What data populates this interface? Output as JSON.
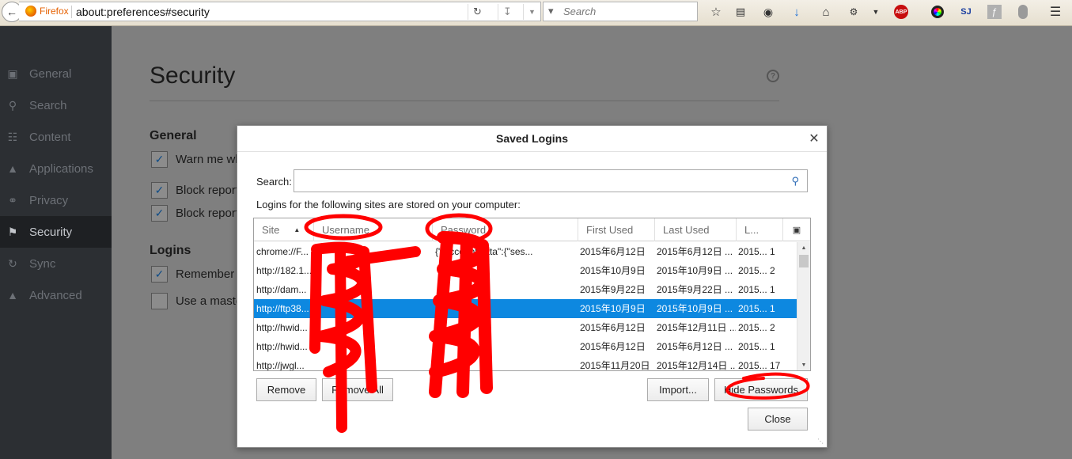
{
  "toolbar": {
    "identity_label": "Firefox",
    "url": "about:preferences#security",
    "search_placeholder": "Search",
    "icons": [
      "back-icon",
      "reload-icon",
      "download-arrow-icon",
      "dropdown-icon",
      "search-icon",
      "star-icon",
      "reading-list-icon",
      "pocket-icon",
      "download-icon",
      "home-icon",
      "extension-icon",
      "abp-icon",
      "color-wheel-icon",
      "sj-icon",
      "flash-icon",
      "addon-icon",
      "menu-icon"
    ],
    "abp_label": "ABP",
    "sj_label": "SJ"
  },
  "sidebar": {
    "items": [
      {
        "label": "General",
        "icon": "general-icon"
      },
      {
        "label": "Search",
        "icon": "search-icon"
      },
      {
        "label": "Content",
        "icon": "content-icon"
      },
      {
        "label": "Applications",
        "icon": "applications-icon"
      },
      {
        "label": "Privacy",
        "icon": "privacy-mask-icon"
      },
      {
        "label": "Security",
        "icon": "lock-icon",
        "active": true
      },
      {
        "label": "Sync",
        "icon": "sync-icon"
      },
      {
        "label": "Advanced",
        "icon": "advanced-icon"
      }
    ]
  },
  "content": {
    "title": "Security",
    "help_glyph": "?",
    "general_heading": "General",
    "general_options": [
      {
        "label": "Warn me wh",
        "checked": true
      },
      {
        "label": "Block report",
        "checked": true
      },
      {
        "label": "Block report",
        "checked": true
      }
    ],
    "logins_heading": "Logins",
    "logins_options": [
      {
        "label": "Remember l",
        "checked": true
      },
      {
        "label": "Use a maste",
        "checked": false
      }
    ]
  },
  "dialog": {
    "title": "Saved Logins",
    "search_label": "Search:",
    "search_value": "",
    "description": "Logins for the following sites are stored on your computer:",
    "columns": [
      "Site",
      "Username",
      "Password",
      "First Used",
      "Last Used",
      "L..."
    ],
    "rows": [
      {
        "site": "chrome://F...",
        "username": "",
        "password": "{\"...ccountData\":{\"ses...",
        "first": "2015年6月12日",
        "last": "2015年6月12日 ...",
        "changed": "2015...",
        "count": "1"
      },
      {
        "site": "http://182.1...",
        "username": "",
        "password": "",
        "first": "2015年10月9日",
        "last": "2015年10月9日 ...",
        "changed": "2015...",
        "count": "2"
      },
      {
        "site": "http://dam...",
        "username": "",
        "password": "",
        "first": "2015年9月22日",
        "last": "2015年9月22日 ...",
        "changed": "2015...",
        "count": "1"
      },
      {
        "site": "http://ftp38...",
        "username": "",
        "password": "",
        "first": "2015年10月9日",
        "last": "2015年10月9日 ...",
        "changed": "2015...",
        "count": "1",
        "selected": true
      },
      {
        "site": "http://hwid...",
        "username": "",
        "password": "",
        "first": "2015年6月12日",
        "last": "2015年12月11日 ...",
        "changed": "2015...",
        "count": "2"
      },
      {
        "site": "http://hwid...",
        "username": "",
        "password": "",
        "first": "2015年6月12日",
        "last": "2015年6月12日 ...",
        "changed": "2015...",
        "count": "1"
      },
      {
        "site": "http://jwgl...",
        "username": "",
        "password": "",
        "first": "2015年11月20日",
        "last": "2015年12月14日 ...",
        "changed": "2015...",
        "count": "17"
      }
    ],
    "buttons": {
      "remove": "Remove",
      "remove_all": "Remove All",
      "import": "Import...",
      "show_passwords": "Hide Passwords",
      "close": "Close"
    }
  },
  "colors": {
    "selection": "#0d88e0",
    "sidebar_bg": "#2c2f33",
    "annotation": "#ff0000"
  }
}
